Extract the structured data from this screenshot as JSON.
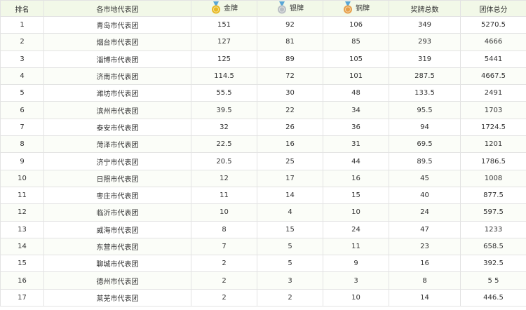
{
  "columns": {
    "rank": "排名",
    "team": "各市地代表团",
    "gold": "金牌",
    "silver": "银牌",
    "bronze": "铜牌",
    "total_medals": "奖牌总数",
    "total_score": "团体总分"
  },
  "medal_colors": {
    "gold": "#e8b923",
    "silver": "#b9bec3",
    "bronze": "#e7a04a",
    "ribbon": "#5aa6d6"
  },
  "rows": [
    {
      "rank": "1",
      "team": "青岛市代表团",
      "gold": "151",
      "silver": "92",
      "bronze": "106",
      "total_medals": "349",
      "total_score": "5270.5"
    },
    {
      "rank": "2",
      "team": "烟台市代表团",
      "gold": "127",
      "silver": "81",
      "bronze": "85",
      "total_medals": "293",
      "total_score": "4666"
    },
    {
      "rank": "3",
      "team": "淄博市代表团",
      "gold": "125",
      "silver": "89",
      "bronze": "105",
      "total_medals": "319",
      "total_score": "5441"
    },
    {
      "rank": "4",
      "team": "济南市代表团",
      "gold": "114.5",
      "silver": "72",
      "bronze": "101",
      "total_medals": "287.5",
      "total_score": "4667.5"
    },
    {
      "rank": "5",
      "team": "潍坊市代表团",
      "gold": "55.5",
      "silver": "30",
      "bronze": "48",
      "total_medals": "133.5",
      "total_score": "2491"
    },
    {
      "rank": "6",
      "team": "滨州市代表团",
      "gold": "39.5",
      "silver": "22",
      "bronze": "34",
      "total_medals": "95.5",
      "total_score": "1703"
    },
    {
      "rank": "7",
      "team": "泰安市代表团",
      "gold": "32",
      "silver": "26",
      "bronze": "36",
      "total_medals": "94",
      "total_score": "1724.5"
    },
    {
      "rank": "8",
      "team": "菏泽市代表团",
      "gold": "22.5",
      "silver": "16",
      "bronze": "31",
      "total_medals": "69.5",
      "total_score": "1201"
    },
    {
      "rank": "9",
      "team": "济宁市代表团",
      "gold": "20.5",
      "silver": "25",
      "bronze": "44",
      "total_medals": "89.5",
      "total_score": "1786.5"
    },
    {
      "rank": "10",
      "team": "日照市代表团",
      "gold": "12",
      "silver": "17",
      "bronze": "16",
      "total_medals": "45",
      "total_score": "1008"
    },
    {
      "rank": "11",
      "team": "枣庄市代表团",
      "gold": "11",
      "silver": "14",
      "bronze": "15",
      "total_medals": "40",
      "total_score": "877.5"
    },
    {
      "rank": "12",
      "team": "临沂市代表团",
      "gold": "10",
      "silver": "4",
      "bronze": "10",
      "total_medals": "24",
      "total_score": "597.5"
    },
    {
      "rank": "13",
      "team": "威海市代表团",
      "gold": "8",
      "silver": "15",
      "bronze": "24",
      "total_medals": "47",
      "total_score": "1233"
    },
    {
      "rank": "14",
      "team": "东营市代表团",
      "gold": "7",
      "silver": "5",
      "bronze": "11",
      "total_medals": "23",
      "total_score": "658.5"
    },
    {
      "rank": "15",
      "team": "聊城市代表团",
      "gold": "2",
      "silver": "5",
      "bronze": "9",
      "total_medals": "16",
      "total_score": "392.5"
    },
    {
      "rank": "16",
      "team": "德州市代表团",
      "gold": "2",
      "silver": "3",
      "bronze": "3",
      "total_medals": "8",
      "total_score": "5 5"
    },
    {
      "rank": "17",
      "team": "莱芜市代表团",
      "gold": "2",
      "silver": "2",
      "bronze": "10",
      "total_medals": "14",
      "total_score": "446.5"
    }
  ]
}
